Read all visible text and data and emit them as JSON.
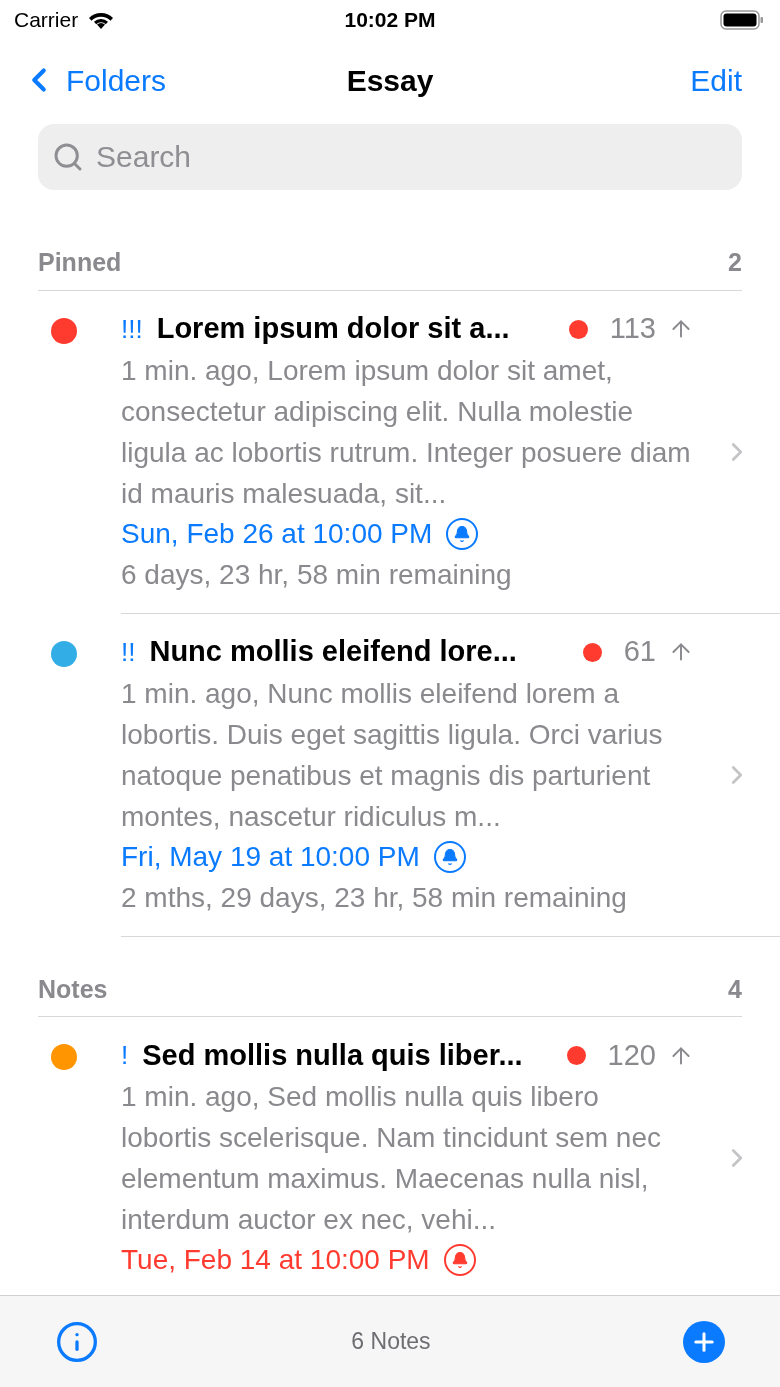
{
  "status_bar": {
    "carrier": "Carrier",
    "time": "10:02 PM"
  },
  "nav": {
    "back": "Folders",
    "title": "Essay",
    "action": "Edit"
  },
  "search": {
    "placeholder": "Search"
  },
  "sections": [
    {
      "title": "Pinned",
      "count": "2",
      "notes": [
        {
          "color": "#ff3b30",
          "priority": "!!!",
          "title": "Lorem ipsum dolor sit a...",
          "count": "113",
          "preview": "1 min. ago, Lorem ipsum dolor sit amet, consectetur adipiscing elit. Nulla molestie ligula ac lobortis rutrum. Integer posuere diam id mauris malesuada, sit...",
          "due": "Sun, Feb 26 at 10:00 PM",
          "overdue": false,
          "remaining": "6 days, 23 hr, 58 min remaining"
        },
        {
          "color": "#32ade6",
          "priority": "!!",
          "title": "Nunc mollis eleifend lore...",
          "count": "61",
          "preview": "1 min. ago, Nunc mollis eleifend lorem a lobortis. Duis eget sagittis ligula. Orci varius natoque penatibus et magnis dis parturient montes, nascetur ridiculus m...",
          "due": "Fri, May 19 at 10:00 PM",
          "overdue": false,
          "remaining": "2 mths, 29 days, 23 hr, 58 min remaining"
        }
      ]
    },
    {
      "title": "Notes",
      "count": "4",
      "notes": [
        {
          "color": "#ff9500",
          "priority": "!",
          "title": "Sed mollis nulla quis liber...",
          "count": "120",
          "preview": "1 min. ago, Sed mollis nulla quis libero lobortis scelerisque. Nam tincidunt sem nec elementum maximus. Maecenas nulla nisl, interdum auctor ex nec, vehi...",
          "due": "Tue, Feb 14 at 10:00 PM",
          "overdue": true
        }
      ]
    }
  ],
  "toolbar": {
    "count": "6 Notes"
  }
}
